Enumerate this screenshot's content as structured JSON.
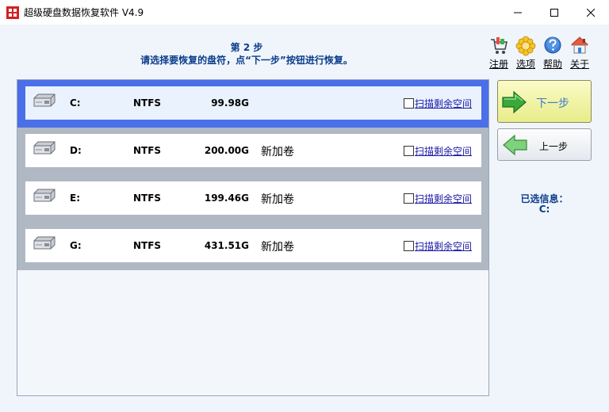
{
  "window": {
    "title": "超级硬盘数据恢复软件 V4.9",
    "minimize_glyph": "—",
    "maximize_glyph": "☐",
    "close_glyph": "✕"
  },
  "header": {
    "step": "第 2 步",
    "instruction": "请选择要恢复的盘符，点“下一步”按钮进行恢复。"
  },
  "toolbar": [
    {
      "label": "注册",
      "icon": "cart-icon"
    },
    {
      "label": "选项",
      "icon": "flower-gear-icon"
    },
    {
      "label": "帮助",
      "icon": "help-icon"
    },
    {
      "label": "关于",
      "icon": "home-icon"
    }
  ],
  "drives": [
    {
      "letter": "C:",
      "fs": "NTFS",
      "size": "99.98G",
      "label": "",
      "checkbox_label": "扫描剩余空间",
      "checked": false,
      "selected": true
    },
    {
      "letter": "D:",
      "fs": "NTFS",
      "size": "200.00G",
      "label": "新加卷",
      "checkbox_label": "扫描剩余空间",
      "checked": false,
      "selected": false
    },
    {
      "letter": "E:",
      "fs": "NTFS",
      "size": "199.46G",
      "label": "新加卷",
      "checkbox_label": "扫描剩余空间",
      "checked": false,
      "selected": false
    },
    {
      "letter": "G:",
      "fs": "NTFS",
      "size": "431.51G",
      "label": "新加卷",
      "checkbox_label": "扫描剩余空间",
      "checked": false,
      "selected": false
    }
  ],
  "buttons": {
    "next": "下一步",
    "prev": "上一步"
  },
  "selected_info": {
    "label": "已选信息：",
    "value": "C:"
  },
  "colors": {
    "accent_blue": "#0a3c8a",
    "selected_row": "#4a6fe8",
    "row_border": "#b0b8c4",
    "next_button": "#e8ec88",
    "arrow_green": "#3aa83a"
  }
}
